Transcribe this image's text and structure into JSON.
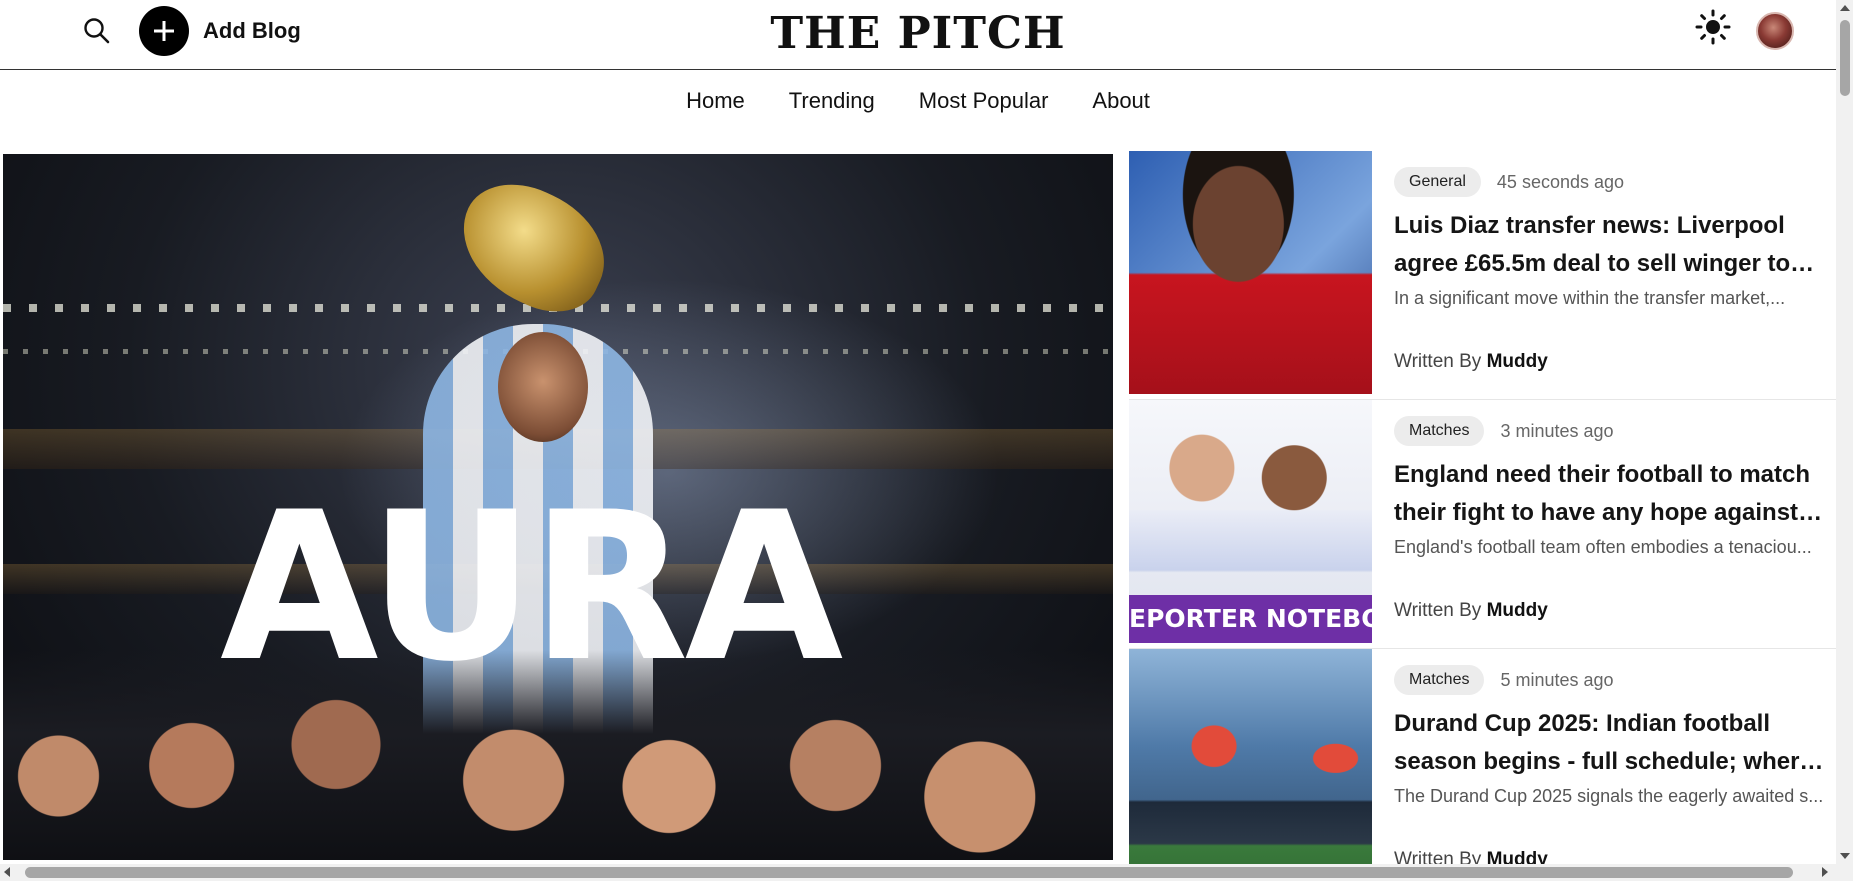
{
  "header": {
    "brand": "THE PITCH",
    "add_blog_label": "Add Blog",
    "icons": [
      "search-icon",
      "plus-icon",
      "sun-icon",
      "avatar"
    ]
  },
  "nav": {
    "items": [
      {
        "label": "Home"
      },
      {
        "label": "Trending"
      },
      {
        "label": "Most Popular"
      },
      {
        "label": "About"
      }
    ]
  },
  "hero": {
    "title": "AURA"
  },
  "posts": [
    {
      "category": "General",
      "time": "45 seconds ago",
      "title": "Luis Diaz transfer news: Liverpool agree £65.5m deal to sell winger to Bayern Munich",
      "excerpt": "In a significant move within the transfer market,...",
      "author_prefix": "Written By",
      "author": "Muddy"
    },
    {
      "category": "Matches",
      "time": "3 minutes ago",
      "title": "England need their football to match their fight to have any hope against Spain",
      "excerpt": "England's football team often embodies a tenaciou...",
      "author_prefix": "Written By",
      "author": "Muddy",
      "thumb_banner": "EPORTER NOTEBOO"
    },
    {
      "category": "Matches",
      "time": "5 minutes ago",
      "title": "Durand Cup 2025: Indian football season begins - full schedule; where to watch",
      "excerpt": "The Durand Cup 2025 signals the eagerly awaited s...",
      "author_prefix": "Written By",
      "author": "Muddy"
    }
  ],
  "colors": {
    "accent": "#000000",
    "tag_bg": "#ececec",
    "thumb_banner": "#6e2fa6"
  }
}
